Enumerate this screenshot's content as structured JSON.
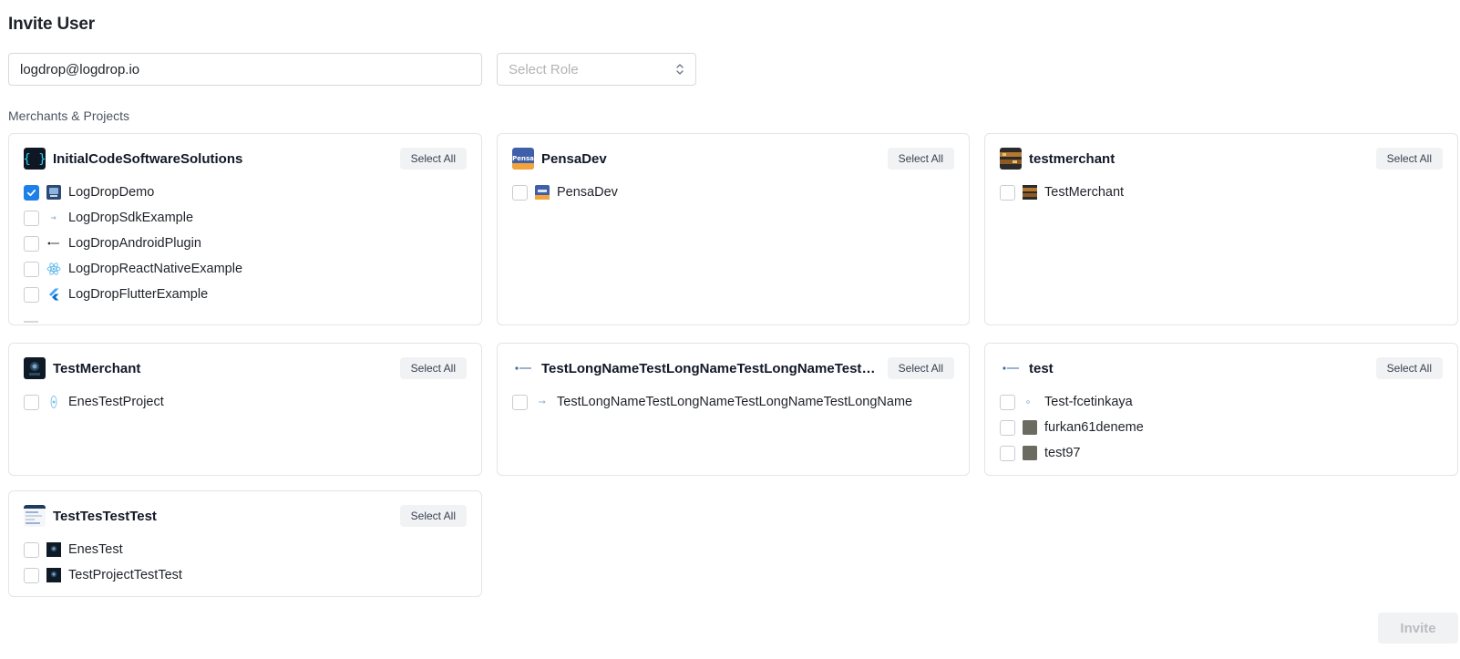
{
  "page": {
    "title": "Invite User",
    "section_label": "Merchants & Projects",
    "invite_label": "Invite"
  },
  "form": {
    "email_value": "logdrop@logdrop.io",
    "role_placeholder": "Select Role"
  },
  "select_all_label": "Select All",
  "merchants": [
    {
      "name": "InitialCodeSoftwareSolutions",
      "logo": "curly-braces-icon",
      "projects": [
        {
          "name": "LogDropDemo",
          "checked": true,
          "icon": "logdrop-demo-icon"
        },
        {
          "name": "LogDropSdkExample",
          "checked": false,
          "icon": "arrow-small-icon"
        },
        {
          "name": "LogDropAndroidPlugin",
          "checked": false,
          "icon": "logdrop-text-icon"
        },
        {
          "name": "LogDropReactNativeExample",
          "checked": false,
          "icon": "react-icon"
        },
        {
          "name": "LogDropFlutterExample",
          "checked": false,
          "icon": "flutter-icon"
        }
      ]
    },
    {
      "name": "PensaDev",
      "logo": "pensa-logo-icon",
      "projects": [
        {
          "name": "PensaDev",
          "checked": false,
          "icon": "pensa-logo-icon"
        }
      ]
    },
    {
      "name": "testmerchant",
      "logo": "photo-thumbnail-icon",
      "projects": [
        {
          "name": "TestMerchant",
          "checked": false,
          "icon": "photo-thumbnail-icon"
        }
      ]
    },
    {
      "name": "TestMerchant",
      "logo": "dark-portrait-icon",
      "projects": [
        {
          "name": "EnesTestProject",
          "checked": false,
          "icon": "react-icon"
        }
      ]
    },
    {
      "name": "TestLongNameTestLongNameTestLongNameTestLongNa...",
      "logo": "logdrop-text-icon",
      "projects": [
        {
          "name": "TestLongNameTestLongNameTestLongNameTestLongName",
          "checked": false,
          "icon": "arrow-small-icon"
        }
      ]
    },
    {
      "name": "test",
      "logo": "logdrop-text-icon",
      "projects": [
        {
          "name": "Test-fcetinkaya",
          "checked": false,
          "icon": "dot-icon"
        },
        {
          "name": "furkan61deneme",
          "checked": false,
          "icon": "gray-square-icon"
        },
        {
          "name": "test97",
          "checked": false,
          "icon": "gray-square-icon"
        }
      ]
    },
    {
      "name": "TestTesTestTest",
      "logo": "screenshot-thumbnail-icon",
      "projects": [
        {
          "name": "EnesTest",
          "checked": false,
          "icon": "dark-portrait-icon"
        },
        {
          "name": "TestProjectTestTest",
          "checked": false,
          "icon": "dark-portrait-icon"
        }
      ]
    }
  ]
}
